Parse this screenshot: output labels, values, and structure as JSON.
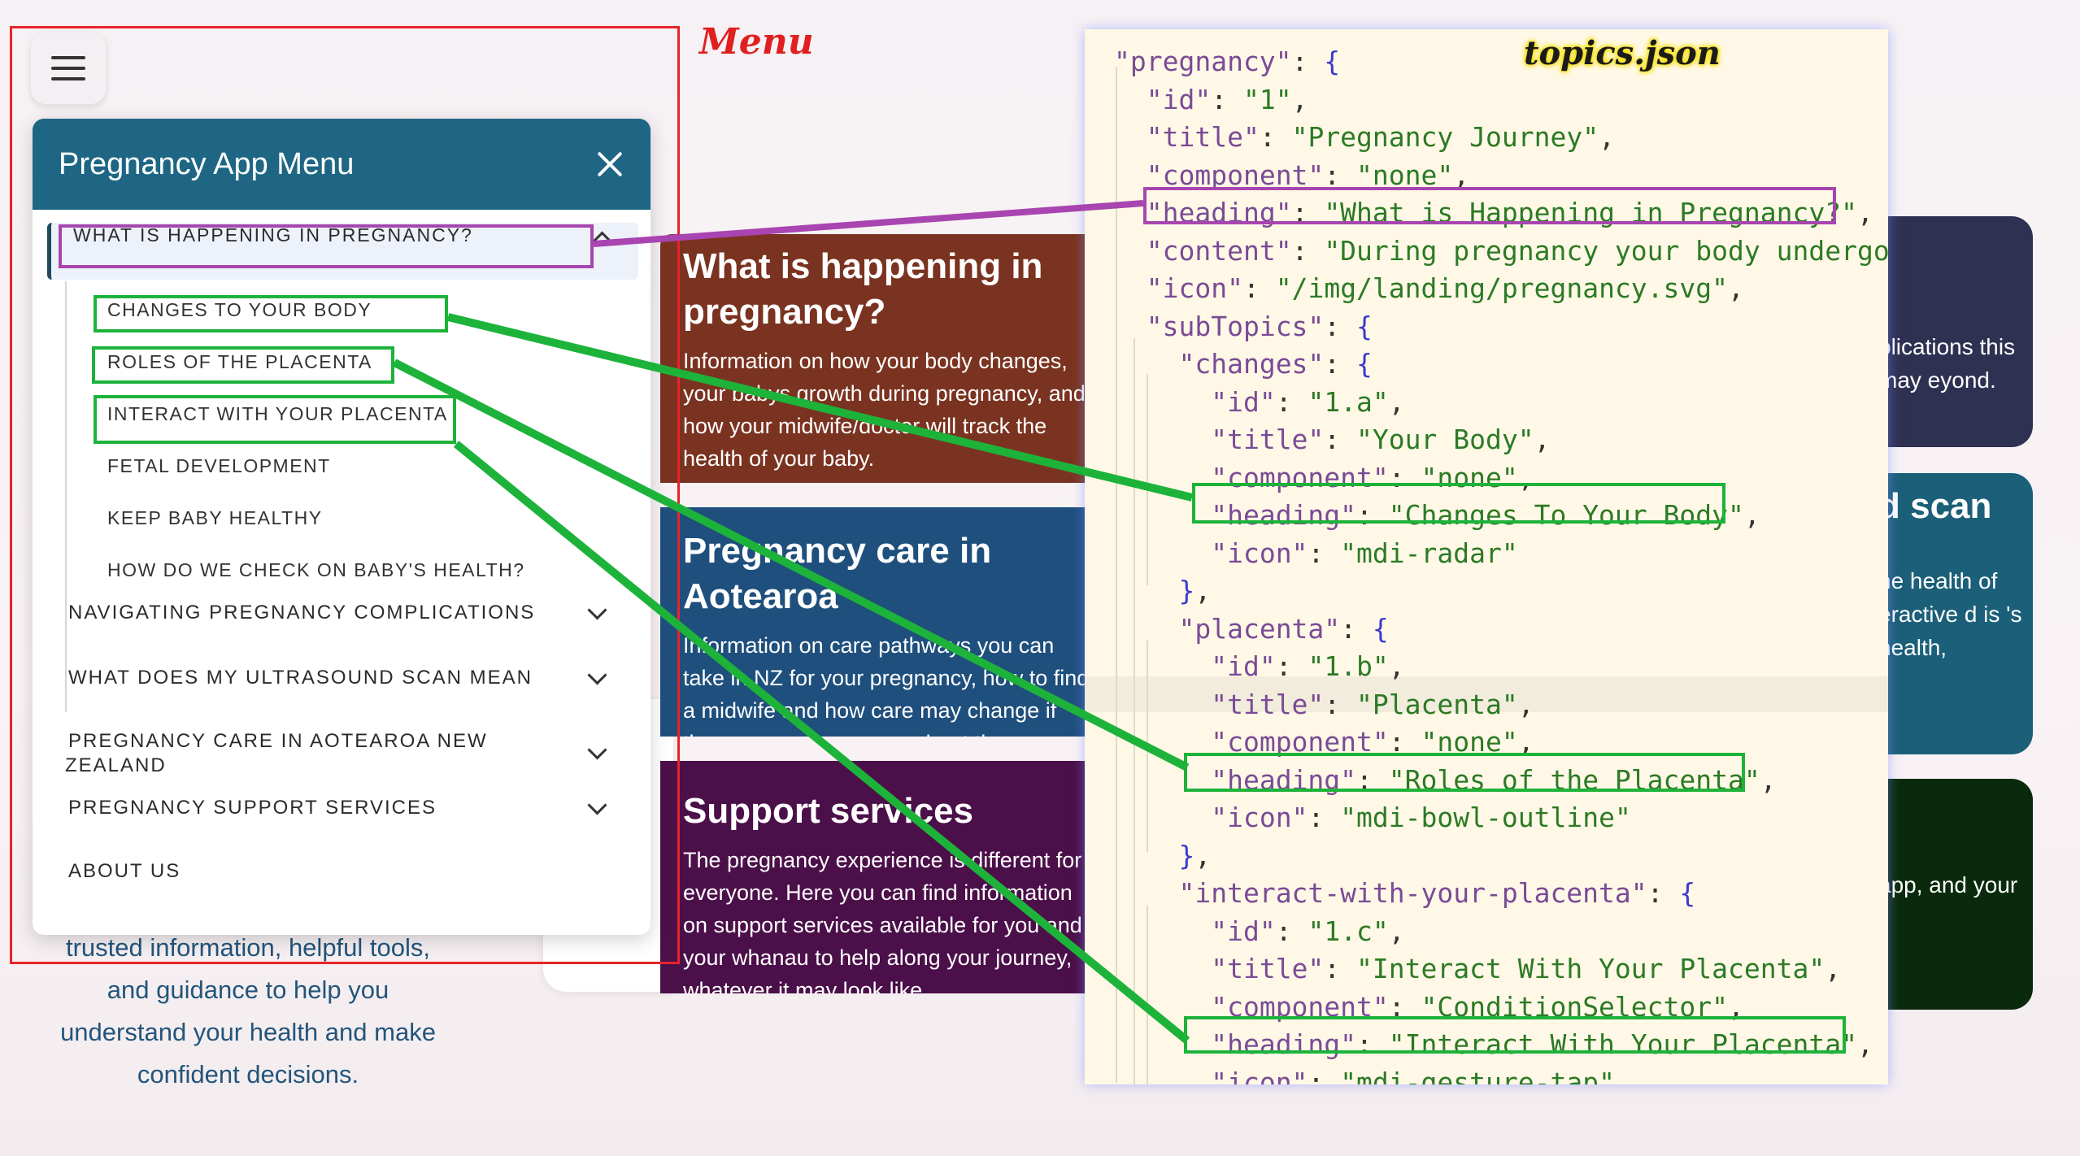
{
  "annotations": {
    "menu_label": "Menu",
    "file_label": "topics.json"
  },
  "drawer": {
    "title": "Pregnancy App Menu",
    "active_item": "WHAT IS HAPPENING IN PREGNANCY?",
    "sub_items": [
      "CHANGES TO YOUR BODY",
      "ROLES OF THE PLACENTA",
      "INTERACT WITH YOUR PLACENTA",
      "FETAL DEVELOPMENT",
      "KEEP BABY HEALTHY",
      "HOW DO WE CHECK ON BABY'S HEALTH?"
    ],
    "items": [
      "NAVIGATING PREGNANCY COMPLICATIONS",
      "WHAT DOES MY ULTRASOUND SCAN MEAN",
      "PREGNANCY CARE IN AOTEAROA NEW",
      "ZEALAND",
      "PREGNANCY SUPPORT SERVICES",
      "ABOUT US"
    ]
  },
  "hero": {
    "lines": [
      "trusted information, helpful tools,",
      "and guidance to help you",
      "understand your health and make",
      "confident decisions."
    ]
  },
  "cards": [
    {
      "title": "What is happening in pregnancy?",
      "text": "Information on how your body changes, your babys growth during pregnancy, and how your midwife/doctor will track the health of your baby."
    },
    {
      "title": "Pregnancy care in Aotearoa",
      "text": "Information on care pathways you can take in NZ for your pregnancy, how to find a midwife and how care may change if there are any concerns about the pregnancy."
    },
    {
      "title": "Support services",
      "text": "The pregnancy experience is different for everyone. Here you can find information on support services available for you and your whanau to help along your journey, whatever it may look like."
    }
  ],
  "right_cards": [
    {
      "title": "",
      "text": "plications this may eyond."
    },
    {
      "title": "d scan",
      "text": "he health of eractive d is 's health,"
    },
    {
      "title": "",
      "text": "app, and your"
    }
  ],
  "code_lines": [
    [
      "\"pregnancy\": {"
    ],
    [
      "  \"id\": \"1\","
    ],
    [
      "  \"title\": \"Pregnancy Journey\","
    ],
    [
      "  \"component\": \"none\","
    ],
    [
      "  \"heading\": \"What is Happening in Pregnancy?\","
    ],
    [
      "  \"content\": \"During pregnancy your body undergoes"
    ],
    [
      "  \"icon\": \"/img/landing/pregnancy.svg\","
    ],
    [
      "  \"subTopics\": {"
    ],
    [
      "    \"changes\": {"
    ],
    [
      "      \"id\": \"1.a\","
    ],
    [
      "      \"title\": \"Your Body\","
    ],
    [
      "      \"component\": \"none\","
    ],
    [
      "      \"heading\": \"Changes To Your Body\","
    ],
    [
      "      \"icon\": \"mdi-radar\""
    ],
    [
      "    },"
    ],
    [
      "    \"placenta\": {"
    ],
    [
      "      \"id\": \"1.b\","
    ],
    [
      "      \"title\": \"Placenta\","
    ],
    [
      "      \"component\": \"none\","
    ],
    [
      "      \"heading\": \"Roles of the Placenta\","
    ],
    [
      "      \"icon\": \"mdi-bowl-outline\""
    ],
    [
      "    },"
    ],
    [
      "    \"interact-with-your-placenta\": {"
    ],
    [
      "      \"id\": \"1.c\","
    ],
    [
      "      \"title\": \"Interact With Your Placenta\","
    ],
    [
      "      \"component\": \"ConditionSelector\","
    ],
    [
      "      \"heading\": \"Interact With Your Placenta\","
    ],
    [
      "      \"icon\": \"mdi-gesture-tap\""
    ]
  ],
  "colors": {
    "drawer_header": "#1e6683",
    "annotation_red": "#e8232a",
    "annotation_purple": "#a845b0",
    "annotation_green": "#1db33a",
    "code_bg": "#fff8e6"
  }
}
